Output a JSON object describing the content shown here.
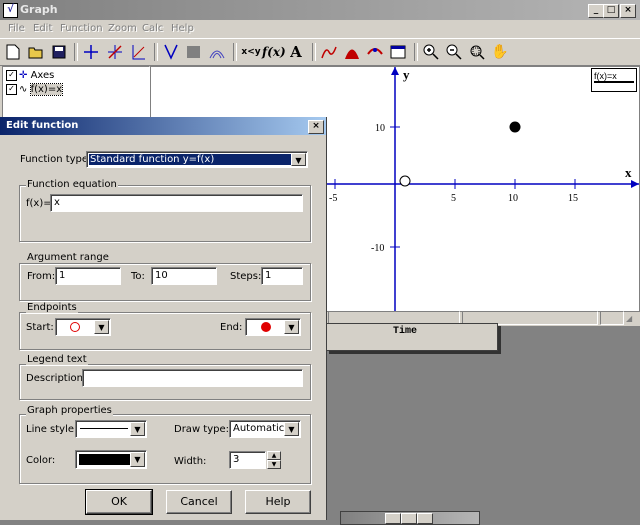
{
  "window": {
    "title": "Graph"
  },
  "menu": [
    "File",
    "Edit",
    "Function",
    "Zoom",
    "Calc",
    "Help"
  ],
  "toolbar": {
    "icons": [
      "new-icon",
      "open-icon",
      "save-icon",
      "axes-icon",
      "insert-function-icon",
      "tangent-icon",
      "shade-icon",
      "relation-icon",
      "point-series-icon",
      "evaluate-icon",
      "derivative-icon",
      "text-icon",
      "trendline-icon",
      "area-icon",
      "intersection-icon",
      "table-icon",
      "zoom-in-icon",
      "zoom-out-icon",
      "zoom-window-icon",
      "pan-icon"
    ],
    "x_label": "x<y",
    "fx_label": "f(x)",
    "text_label": "A"
  },
  "tree": {
    "items": [
      {
        "label": "Axes",
        "checked": true
      },
      {
        "label": "f(x)=x",
        "checked": true
      }
    ]
  },
  "graph": {
    "x_axis_label": "x",
    "y_axis_label": "y",
    "x_ticks": [
      "-5",
      "5",
      "10",
      "15"
    ],
    "y_ticks": [
      "10",
      "-10"
    ],
    "legend": "f(x)=x"
  },
  "background_windows": {
    "table_header": "Time"
  },
  "dialog": {
    "title": "Edit function",
    "function_type_label": "Function type:",
    "function_type_value": "Standard function   y=f(x)",
    "equation_group": "Function equation",
    "equation_prefix": "f(x)=",
    "equation_value": "x",
    "range_group": "Argument range",
    "from_label": "From:",
    "from_value": "1",
    "to_label": "To:",
    "to_value": "10",
    "steps_label": "Steps:",
    "steps_value": "1",
    "endpoints_group": "Endpoints",
    "start_label": "Start:",
    "end_label": "End:",
    "legend_group": "Legend text",
    "description_label": "Description:",
    "description_value": "",
    "graph_props_group": "Graph properties",
    "line_style_label": "Line style:",
    "draw_type_label": "Draw type:",
    "draw_type_value": "Automatic",
    "color_label": "Color:",
    "color_value": "#000000",
    "width_label": "Width:",
    "width_value": "3",
    "ok": "OK",
    "cancel": "Cancel",
    "help": "Help"
  }
}
